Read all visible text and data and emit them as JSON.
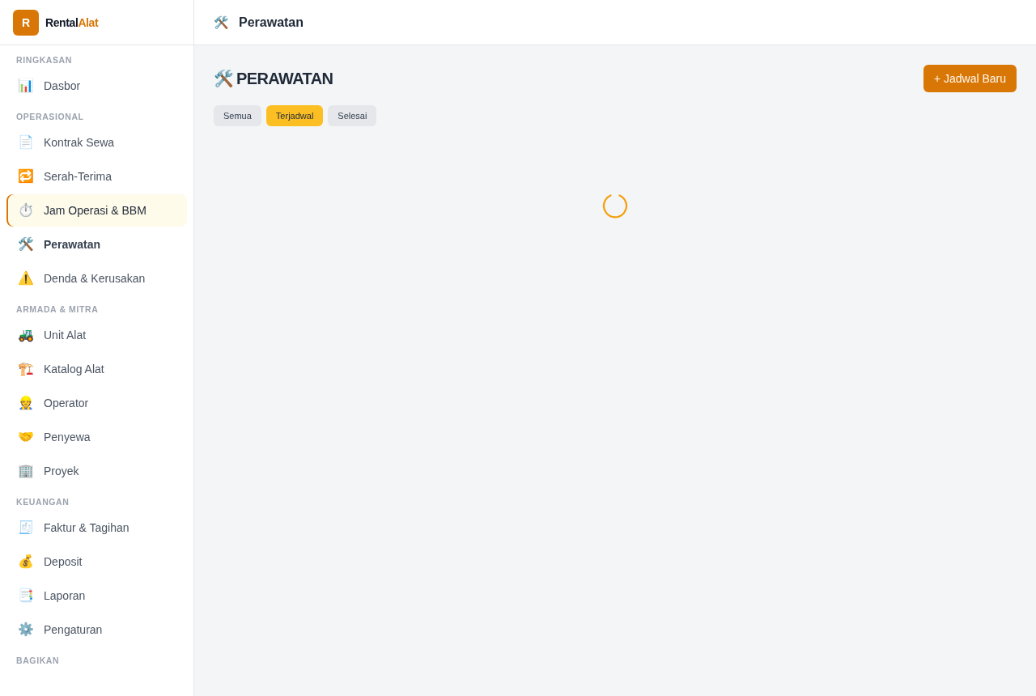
{
  "brand": {
    "mark": "R",
    "name": "Rental",
    "name_accent": "Alat"
  },
  "sidebar": {
    "sections": [
      {
        "title": "RINGKASAN",
        "items": [
          {
            "icon": "📊",
            "label": "Dasbor",
            "selected": false,
            "highlighted": false
          }
        ]
      },
      {
        "title": "OPERASIONAL",
        "items": [
          {
            "icon": "📄",
            "label": "Kontrak Sewa",
            "selected": false,
            "highlighted": false
          },
          {
            "icon": "🔁",
            "label": "Serah-Terima",
            "selected": false,
            "highlighted": false
          },
          {
            "icon": "⏱️",
            "label": "Jam Operasi & BBM",
            "selected": false,
            "highlighted": true
          },
          {
            "icon": "🛠️",
            "label": "Perawatan",
            "selected": true,
            "highlighted": false
          },
          {
            "icon": "⚠️",
            "label": "Denda & Kerusakan",
            "selected": false,
            "highlighted": false
          }
        ]
      },
      {
        "title": "ARMADA & MITRA",
        "items": [
          {
            "icon": "🚜",
            "label": "Unit Alat",
            "selected": false,
            "highlighted": false
          },
          {
            "icon": "🏗️",
            "label": "Katalog Alat",
            "selected": false,
            "highlighted": false
          },
          {
            "icon": "👷",
            "label": "Operator",
            "selected": false,
            "highlighted": false
          },
          {
            "icon": "🤝",
            "label": "Penyewa",
            "selected": false,
            "highlighted": false
          },
          {
            "icon": "🏢",
            "label": "Proyek",
            "selected": false,
            "highlighted": false
          }
        ]
      },
      {
        "title": "KEUANGAN",
        "items": [
          {
            "icon": "🧾",
            "label": "Faktur & Tagihan",
            "selected": false,
            "highlighted": false
          },
          {
            "icon": "💰",
            "label": "Deposit",
            "selected": false,
            "highlighted": false
          },
          {
            "icon": "📑",
            "label": "Laporan",
            "selected": false,
            "highlighted": false
          },
          {
            "icon": "⚙️",
            "label": "Pengaturan",
            "selected": false,
            "highlighted": false
          }
        ]
      },
      {
        "title": "BAGIKAN"
      }
    ]
  },
  "topbar": {
    "icon": "🛠️",
    "title": "Perawatan"
  },
  "page": {
    "heading_icon": "🛠️",
    "heading": "PERAWATAN",
    "new_button": "+ Jadwal Baru",
    "filters": [
      {
        "label": "Semua",
        "selected": false
      },
      {
        "label": "Terjadwal",
        "selected": true
      },
      {
        "label": "Selesai",
        "selected": false
      }
    ],
    "loading": true
  }
}
